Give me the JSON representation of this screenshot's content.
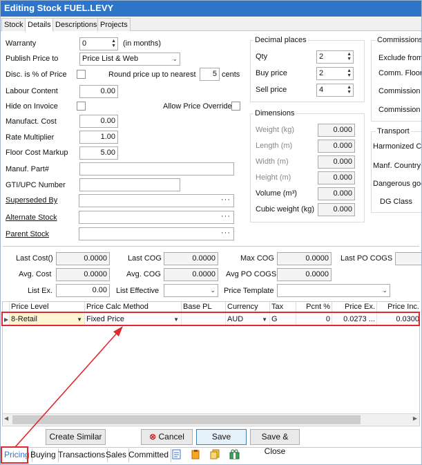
{
  "window": {
    "title": "Editing Stock FUEL.LEVY"
  },
  "tabs": [
    "Stock",
    "Details",
    "Descriptions",
    "Projects"
  ],
  "details": {
    "warranty_label": "Warranty",
    "warranty_value": "0",
    "warranty_unit": "(in months)",
    "publish_price_label": "Publish Price to",
    "publish_price_value": "Price List & Web",
    "disc_pct_label": "Disc. is % of Price",
    "round_label": "Round price up to nearest",
    "round_value": "5",
    "round_unit": "cents",
    "labour_label": "Labour Content",
    "labour_value": "0.00",
    "hide_invoice_label": "Hide on Invoice",
    "allow_override_label": "Allow Price Override",
    "manufact_cost_label": "Manufact. Cost",
    "manufact_cost_value": "0.00",
    "rate_mult_label": "Rate Multiplier",
    "rate_mult_value": "1.00",
    "floor_markup_label": "Floor Cost Markup",
    "floor_markup_value": "5.00",
    "manuf_part_label": "Manuf. Part#",
    "manuf_part_value": "",
    "gti_label": "GTI/UPC Number",
    "gti_value": "",
    "superseded_label": "Superseded By",
    "alternate_label": "Alternate Stock",
    "parent_label": "Parent Stock",
    "ellipsis": "···"
  },
  "decimal_places": {
    "title": "Decimal places",
    "qty_label": "Qty",
    "qty_value": "2",
    "buy_label": "Buy price",
    "buy_value": "2",
    "sell_label": "Sell price",
    "sell_value": "4"
  },
  "dimensions": {
    "title": "Dimensions",
    "weight_label": "Weight (kg)",
    "weight_value": "0.000",
    "length_label": "Length (m)",
    "length_value": "0.000",
    "width_label": "Width (m)",
    "width_value": "0.000",
    "height_label": "Height (m)",
    "height_value": "0.000",
    "volume_label": "Volume (m³)",
    "volume_value": "0.000",
    "cubic_label": "Cubic weight (kg)",
    "cubic_value": "0.000"
  },
  "commissions": {
    "title": "Commissions",
    "exclude_label": "Exclude from",
    "floor_label": "Comm. Floor",
    "pct_label": "Commission %",
    "basis_label": "Commission B"
  },
  "transport": {
    "title": "Transport",
    "harmonized_label": "Harmonized Co",
    "country_label": "Manf. Country",
    "dangerous_label": "Dangerous goo",
    "dg_class_label": "DG Class"
  },
  "costs": {
    "last_cost_label": "Last Cost()",
    "last_cost_value": "0.0000",
    "last_cog_label": "Last COG",
    "last_cog_value": "0.0000",
    "max_cog_label": "Max COG",
    "max_cog_value": "0.0000",
    "last_po_label": "Last PO COGS",
    "avg_cost_label": "Avg. Cost",
    "avg_cost_value": "0.0000",
    "avg_cog_label": "Avg. COG",
    "avg_cog_value": "0.0000",
    "avg_po_label": "Avg PO COGS",
    "avg_po_value": "0.0000",
    "list_ex_label": "List Ex.",
    "list_ex_value": "0.00",
    "list_eff_label": "List Effective",
    "price_template_label": "Price Template"
  },
  "price_grid": {
    "columns": [
      "Price Level",
      "Price Calc Method",
      "Base PL",
      "Currency",
      "Tax",
      "Pcnt %",
      "Price Ex.",
      "Price Inc."
    ],
    "row": {
      "price_level": "8-Retail",
      "calc_method": "Fixed Price",
      "base_pl": "",
      "currency": "AUD",
      "tax": "G",
      "pcnt": "0",
      "price_ex": "0.0273 ...",
      "price_inc": "0.0300"
    },
    "highlight_color": "#e0282e",
    "active_cell_color": "#fff7d1"
  },
  "buttons": {
    "create_similar": "Create Similar",
    "cancel": "Cancel",
    "save": "Save",
    "save_close": "Save & Close"
  },
  "bottom_tabs": [
    "Pricing",
    "Buying",
    "Transactions",
    "Sales",
    "Committed"
  ],
  "bottom_icons": [
    "notes-icon",
    "clipboard-icon",
    "documents-icon",
    "gift-icon"
  ],
  "colors": {
    "title_bg": "#2e74c8",
    "accent": "#2e74c8",
    "annotation": "#e0282e"
  }
}
